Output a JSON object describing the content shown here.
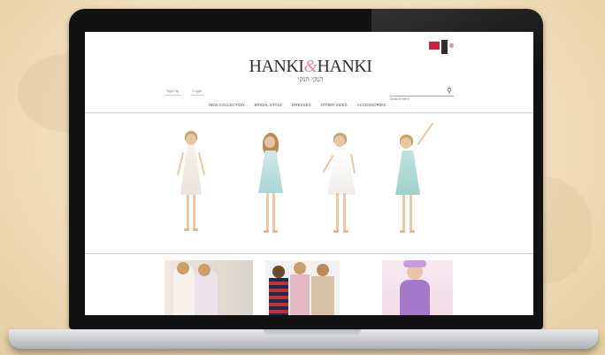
{
  "site": {
    "brand_left": "HANKI",
    "brand_amp": "&",
    "brand_right": "HANKI",
    "brand_sub": "הנקי הנקי"
  },
  "account": [
    "Sign Up",
    "Login"
  ],
  "search": {
    "placeholder": "Search here"
  },
  "nav": [
    "NEW COLLECTION",
    "BRIDAL STYLE",
    "DRESSES",
    "OTHER SIZES",
    "ACCESSORIES"
  ],
  "colors": {
    "accent": "#e08a9a",
    "lid": "#121212",
    "background": "#efdcb8"
  }
}
